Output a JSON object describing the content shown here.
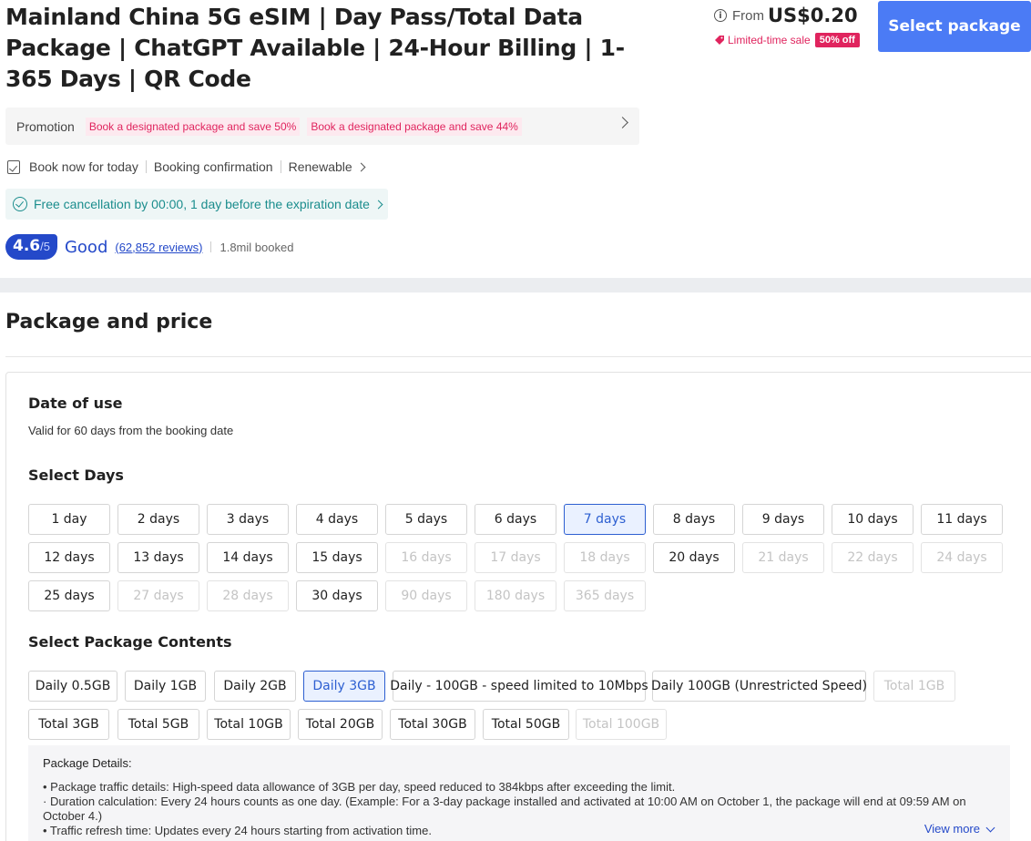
{
  "product": {
    "title": "Mainland China 5G eSIM | Day Pass/Total Data Package | ChatGPT Available | 24-Hour Billing | 1-365 Days | QR Code"
  },
  "pricing": {
    "from_label": "From",
    "price": "US$0.20",
    "sale_label": "Limited-time sale",
    "discount_badge": "50% off",
    "select_button": "Select package",
    "info_icon": "info-icon",
    "tag_icon": "price-tag-icon"
  },
  "promotion": {
    "label": "Promotion",
    "tags": [
      "Book a designated package and save 50%",
      "Book a designated package and save 44%"
    ]
  },
  "booking": {
    "items": [
      "Book now for today",
      "Booking confirmation",
      "Renewable"
    ]
  },
  "cancellation": {
    "text": "Free cancellation by 00:00, 1 day before the expiration date"
  },
  "rating": {
    "score": "4.6",
    "out_of": "/5",
    "label": "Good",
    "reviews": "(62,852 reviews)",
    "booked": "1.8mil booked"
  },
  "package_section": {
    "title": "Package and price",
    "date_of_use": {
      "heading": "Date of use",
      "subtext": "Valid for 60 days from the booking date"
    },
    "days": {
      "heading": "Select Days",
      "options": [
        {
          "label": "1 day",
          "state": "normal"
        },
        {
          "label": "2 days",
          "state": "normal"
        },
        {
          "label": "3 days",
          "state": "normal"
        },
        {
          "label": "4 days",
          "state": "normal"
        },
        {
          "label": "5 days",
          "state": "normal"
        },
        {
          "label": "6 days",
          "state": "normal"
        },
        {
          "label": "7 days",
          "state": "selected"
        },
        {
          "label": "8 days",
          "state": "normal"
        },
        {
          "label": "9 days",
          "state": "normal"
        },
        {
          "label": "10 days",
          "state": "normal"
        },
        {
          "label": "11 days",
          "state": "normal"
        },
        {
          "label": "12 days",
          "state": "normal"
        },
        {
          "label": "13 days",
          "state": "normal"
        },
        {
          "label": "14 days",
          "state": "normal"
        },
        {
          "label": "15 days",
          "state": "normal"
        },
        {
          "label": "16 days",
          "state": "disabled"
        },
        {
          "label": "17 days",
          "state": "disabled"
        },
        {
          "label": "18 days",
          "state": "disabled"
        },
        {
          "label": "20 days",
          "state": "normal"
        },
        {
          "label": "21 days",
          "state": "disabled"
        },
        {
          "label": "22 days",
          "state": "disabled"
        },
        {
          "label": "24 days",
          "state": "disabled"
        },
        {
          "label": "25 days",
          "state": "normal"
        },
        {
          "label": "27 days",
          "state": "disabled"
        },
        {
          "label": "28 days",
          "state": "disabled"
        },
        {
          "label": "30 days",
          "state": "normal"
        },
        {
          "label": "90 days",
          "state": "disabled"
        },
        {
          "label": "180 days",
          "state": "disabled"
        },
        {
          "label": "365 days",
          "state": "disabled"
        }
      ]
    },
    "contents": {
      "heading": "Select Package Contents",
      "options": [
        {
          "label": "Daily 0.5GB",
          "state": "normal"
        },
        {
          "label": "Daily 1GB",
          "state": "normal"
        },
        {
          "label": "Daily 2GB",
          "state": "normal"
        },
        {
          "label": "Daily 3GB",
          "state": "selected"
        },
        {
          "label": "Daily - 100GB - speed limited to 10Mbps",
          "state": "normal"
        },
        {
          "label": "Daily 100GB (Unrestricted Speed)",
          "state": "normal"
        },
        {
          "label": "Total 1GB",
          "state": "disabled"
        },
        {
          "label": "Total 3GB",
          "state": "normal"
        },
        {
          "label": "Total 5GB",
          "state": "normal"
        },
        {
          "label": "Total 10GB",
          "state": "normal"
        },
        {
          "label": "Total 20GB",
          "state": "normal"
        },
        {
          "label": "Total 30GB",
          "state": "normal"
        },
        {
          "label": "Total 50GB",
          "state": "normal"
        },
        {
          "label": "Total 100GB",
          "state": "disabled"
        }
      ]
    },
    "details": {
      "heading": "Package Details:",
      "lines": [
        "• Package traffic details: High-speed data allowance of 3GB per day, speed reduced to 384kbps after exceeding the limit.",
        "· Duration calculation: Every 24 hours counts as one day. (Example: For a 3-day package installed and activated at 10:00 AM on October 1, the package will end at 09:59 AM on October 4.)",
        "• Traffic refresh time: Updates every 24 hours starting from activation time."
      ],
      "view_more": "View more"
    }
  },
  "colors": {
    "primary_button": "#4b7bf5",
    "sale_accent": "#e0245e",
    "rating_blue": "#2449c9",
    "cancel_teal": "#1b8d8d",
    "selected_chip_border": "#2d5fd1"
  }
}
